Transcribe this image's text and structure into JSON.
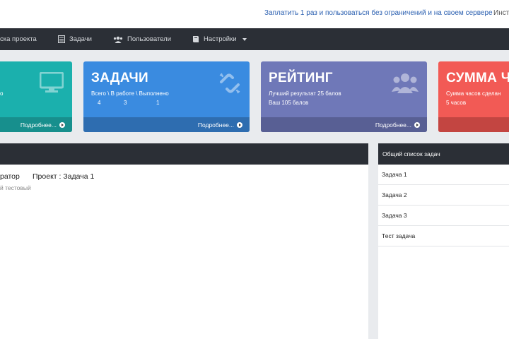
{
  "topbar": {
    "promo_link": "Заплатить 1 раз и пользоваться без ограничений и на своем сервере",
    "instr_link": "Инст"
  },
  "nav": {
    "items": [
      {
        "label": "ска проекта",
        "icon": "none"
      },
      {
        "label": "Задачи",
        "icon": "list-icon"
      },
      {
        "label": "Пользователи",
        "icon": "users-icon"
      },
      {
        "label": "Настройки",
        "icon": "book-icon"
      }
    ]
  },
  "cards": [
    {
      "title": "",
      "sub": "о",
      "sub2": "",
      "more": "Подробнее...",
      "color": "#1bb0ad",
      "footer_color": "#178f8d",
      "icon": "monitor-icon"
    },
    {
      "title": "ЗАДАЧИ",
      "sub": "Всего \\ В работе \\ Выполнено",
      "counts": [
        "4",
        "3",
        "1"
      ],
      "more": "Подробнее...",
      "color": "#3a8be0",
      "footer_color": "#2e6db0",
      "icon": "link-broken-icon"
    },
    {
      "title": "РЕЙТИНГ",
      "sub": "Лучший результат 25 балов",
      "sub2": "Ваш 105 балов",
      "more": "Подробнее...",
      "color": "#6f78b8",
      "footer_color": "#585f94",
      "icon": "users-icon"
    },
    {
      "title": "СУММА ЧА",
      "sub": "Сумма часов сделан",
      "sub2": "5 часов",
      "more": "",
      "color": "#f25a55",
      "footer_color": "#c34541",
      "icon": "none"
    }
  ],
  "main": {
    "entry_role": "ратор",
    "entry_project": "Проект : Задача 1",
    "entry_desc": "й тестовый"
  },
  "task_list": {
    "header": "Общий список задач",
    "items": [
      "Задача 1",
      "Задача 2",
      "Задача 3",
      "Тест задача"
    ]
  }
}
